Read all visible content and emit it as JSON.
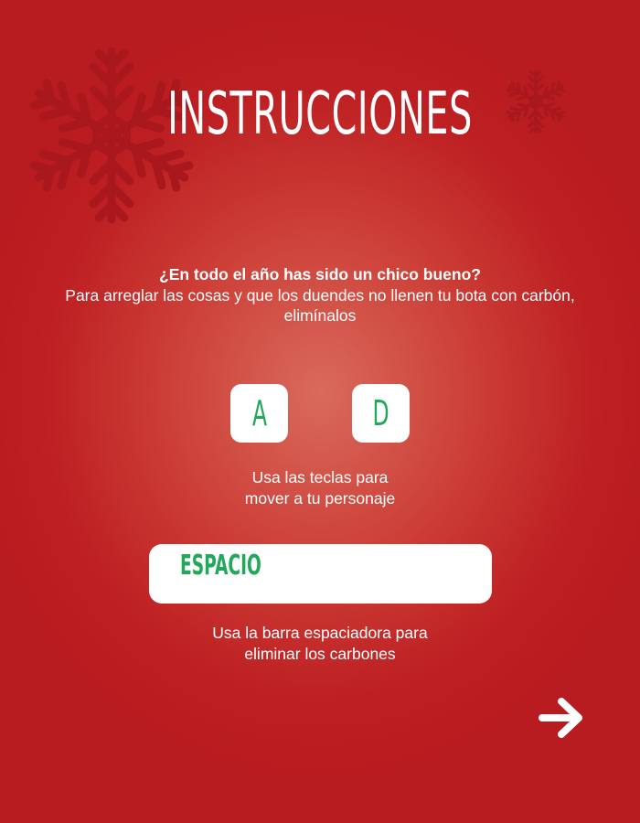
{
  "screen": {
    "title": "INSTRUCCIONES",
    "intro_question": "¿En todo el año has sido un chico bueno?",
    "intro_body": "Para arreglar las cosas y que los duendes no llenen tu bota con carbón, elimínalos"
  },
  "controls": {
    "move_keys": [
      "A",
      "D"
    ],
    "move_caption_line1": "Usa las teclas para",
    "move_caption_line2": "mover a tu personaje",
    "space_key": "ESPACIO",
    "space_caption_line1": "Usa la barra espaciadora para",
    "space_caption_line2": "eliminar los carbones"
  },
  "navigation": {
    "next_icon": "arrow-right-icon"
  },
  "decorations": [
    "snowflake-icon",
    "snowflake-icon"
  ],
  "colors": {
    "background": "#bd1f22",
    "key_text": "#22a85a",
    "snowflake": "#a8181c",
    "text": "#ffffff"
  }
}
